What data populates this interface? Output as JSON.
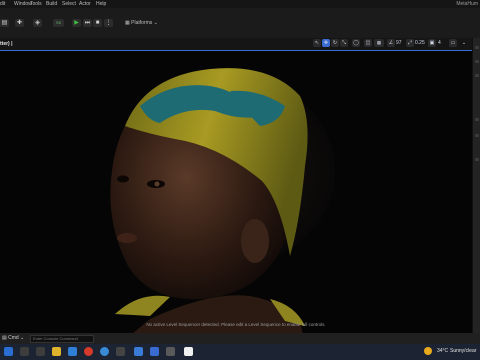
{
  "menubar": {
    "items": [
      "dit",
      "Window",
      "Tools",
      "Build",
      "Select",
      "Actor",
      "Help"
    ],
    "app_title": "MetaHum"
  },
  "toolbar": {
    "platforms_label": "Platforms",
    "mode_label": "S0"
  },
  "viewport": {
    "tab_title": "tter) |",
    "header_num_a": "97",
    "header_num_b": "0.25",
    "header_num_c": "4",
    "status_message": "No active Level Sequencer detected. Please edit a Level Sequence to enable full controls."
  },
  "bottom": {
    "drawer_label": "Cmd",
    "cmd_placeholder": "Enter Console Command"
  },
  "taskbar": {
    "temperature": "34°C",
    "weather_status": "Sunny/clear"
  },
  "colors": {
    "accent_blue": "#3a6bd1",
    "play_green": "#3fbf3f",
    "taskbar_bg": "#1c2433"
  }
}
